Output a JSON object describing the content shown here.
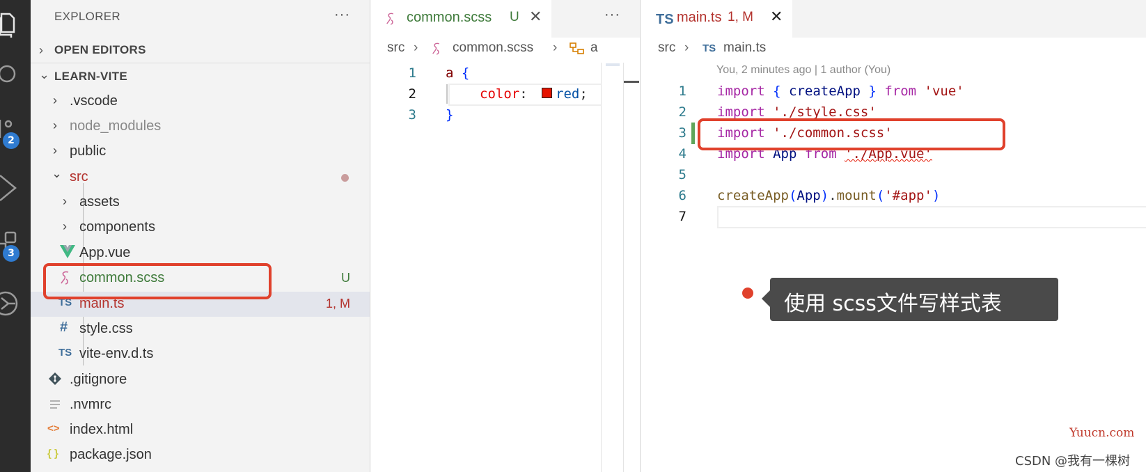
{
  "activity_bar": {
    "source_control_badge": "2",
    "extensions_badge": "3"
  },
  "explorer": {
    "title": "EXPLORER",
    "more": "···",
    "open_editors_label": "OPEN EDITORS",
    "project_label": "LEARN-VITE",
    "items": [
      {
        "name": ".vscode",
        "kind": "folder"
      },
      {
        "name": "node_modules",
        "kind": "folder"
      },
      {
        "name": "public",
        "kind": "folder"
      },
      {
        "name": "src",
        "kind": "folder-open"
      },
      {
        "name": "assets",
        "kind": "folder"
      },
      {
        "name": "components",
        "kind": "folder"
      },
      {
        "name": "App.vue",
        "kind": "vue"
      },
      {
        "name": "common.scss",
        "kind": "scss",
        "status": "U"
      },
      {
        "name": "main.ts",
        "kind": "ts",
        "status": "1, M"
      },
      {
        "name": "style.css",
        "kind": "css"
      },
      {
        "name": "vite-env.d.ts",
        "kind": "ts"
      },
      {
        "name": ".gitignore",
        "kind": "git"
      },
      {
        "name": ".nvmrc",
        "kind": "text"
      },
      {
        "name": "index.html",
        "kind": "html"
      },
      {
        "name": "package.json",
        "kind": "json"
      }
    ]
  },
  "icons": {
    "ts": "TS",
    "css": "#",
    "json": "{ }",
    "html": "<>",
    "chevron_right": "›",
    "chevron_down": "⌄",
    "close": "✕"
  },
  "editor_left": {
    "tab_name": "common.scss",
    "tab_status": "U",
    "more": "···",
    "breadcrumb": [
      "src",
      "common.scss",
      "a"
    ],
    "line_numbers": [
      "1",
      "2",
      "3"
    ],
    "code": {
      "l1_selector": "a",
      "l1_brace": "{",
      "l2_prop": "color",
      "l2_colon": ":",
      "l2_value": "red",
      "l2_semi": ";",
      "l3_brace": "}"
    },
    "swatch_color": "#e51400"
  },
  "editor_right": {
    "tab_name": "main.ts",
    "tab_status": "1, M",
    "breadcrumb": [
      "src",
      "main.ts"
    ],
    "blame": "You, 2 minutes ago | 1 author (You)",
    "line_numbers": [
      "1",
      "2",
      "3",
      "4",
      "5",
      "6",
      "7"
    ],
    "code": {
      "import": "import",
      "from": "from",
      "l1_open": "{",
      "l1_name": "createApp",
      "l1_close": "}",
      "l1_module": "'vue'",
      "l2_module": "'./style.css'",
      "l3_module": "'./common.scss'",
      "l4_name": "App",
      "l4_module": "'./App.vue'",
      "l6_fn": "createApp",
      "l6_arg": "App",
      "l6_method": "mount",
      "l6_selector": "'#app'"
    }
  },
  "callout": {
    "text": "使用 scss文件写样式表"
  },
  "watermarks": {
    "site": "Yuucn.com",
    "author": "CSDN @我有一棵树"
  },
  "colors": {
    "highlight": "#e0412c",
    "activity_bar": "#2c2c2c",
    "badge": "#2f7bd0",
    "untracked": "#3f7b3b",
    "modified": "#b3322d"
  }
}
